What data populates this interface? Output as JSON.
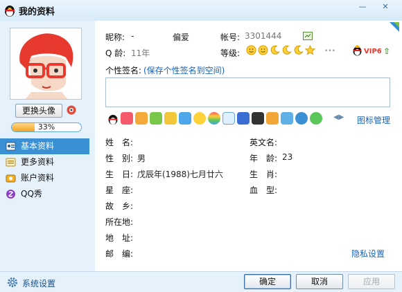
{
  "window": {
    "title": "我的资料",
    "min_glyph": "—",
    "close_glyph": "✕"
  },
  "sidebar": {
    "change_avatar_label": "更换头像",
    "completion_percent": 33,
    "completion_text": "33%",
    "items": [
      {
        "label": "基本资料",
        "icon": "profile-card-icon",
        "active": true
      },
      {
        "label": "更多资料",
        "icon": "more-info-icon",
        "active": false
      },
      {
        "label": "账户资料",
        "icon": "account-icon",
        "active": false
      },
      {
        "label": "QQ秀",
        "icon": "qq-show-icon",
        "active": false
      }
    ]
  },
  "profile": {
    "nickname_label": "昵称:",
    "nickname_value": "-",
    "hobby": "偏爱",
    "account_label": "帐号:",
    "account_value": "3301444",
    "q_age_label": "Q 龄:",
    "q_age_value": "11年",
    "level_label": "等级:",
    "vip_label": "VIP6",
    "signature_label": "个性签名:",
    "signature_link": "(保存个性签名到空间)",
    "signature_value": ""
  },
  "service_strip": {
    "icons": [
      "qq-penguin-icon",
      "red-diamond-icon",
      "yellow-diamond-icon",
      "game-icon",
      "gold-icon",
      "blue-diamond-icon",
      "search-plus-icon",
      "rainbow-icon",
      "mail-icon",
      "music-icon",
      "penguin-game-icon",
      "qzone-icon",
      "pet-icon",
      "disk-icon",
      "green-orb-icon"
    ],
    "manage_label": "图标管理"
  },
  "details": {
    "left": [
      {
        "label": "姓　名:",
        "value": ""
      },
      {
        "label": "性　别:",
        "value": "男"
      },
      {
        "label": "生　日:",
        "value": "戊辰年(1988)七月廿六"
      },
      {
        "label": "星　座:",
        "value": ""
      },
      {
        "label": "故　乡:",
        "value": ""
      },
      {
        "label": "所在地:",
        "value": ""
      },
      {
        "label": "地　址:",
        "value": ""
      },
      {
        "label": "邮　编:",
        "value": ""
      }
    ],
    "right": [
      {
        "label": "英文名:",
        "value": ""
      },
      {
        "label": "年　龄:",
        "value": "23"
      },
      {
        "label": "生　肖:",
        "value": ""
      },
      {
        "label": "血　型:",
        "value": ""
      }
    ],
    "privacy_link": "隐私设置"
  },
  "footer": {
    "settings_label": "系统设置",
    "ok_label": "确定",
    "cancel_label": "取消",
    "apply_label": "应用"
  },
  "colors": {
    "accent": "#3b8fd3",
    "link": "#1a63b8",
    "sidebar_bg": "#e6f2fb",
    "progress": "#f1a321"
  }
}
